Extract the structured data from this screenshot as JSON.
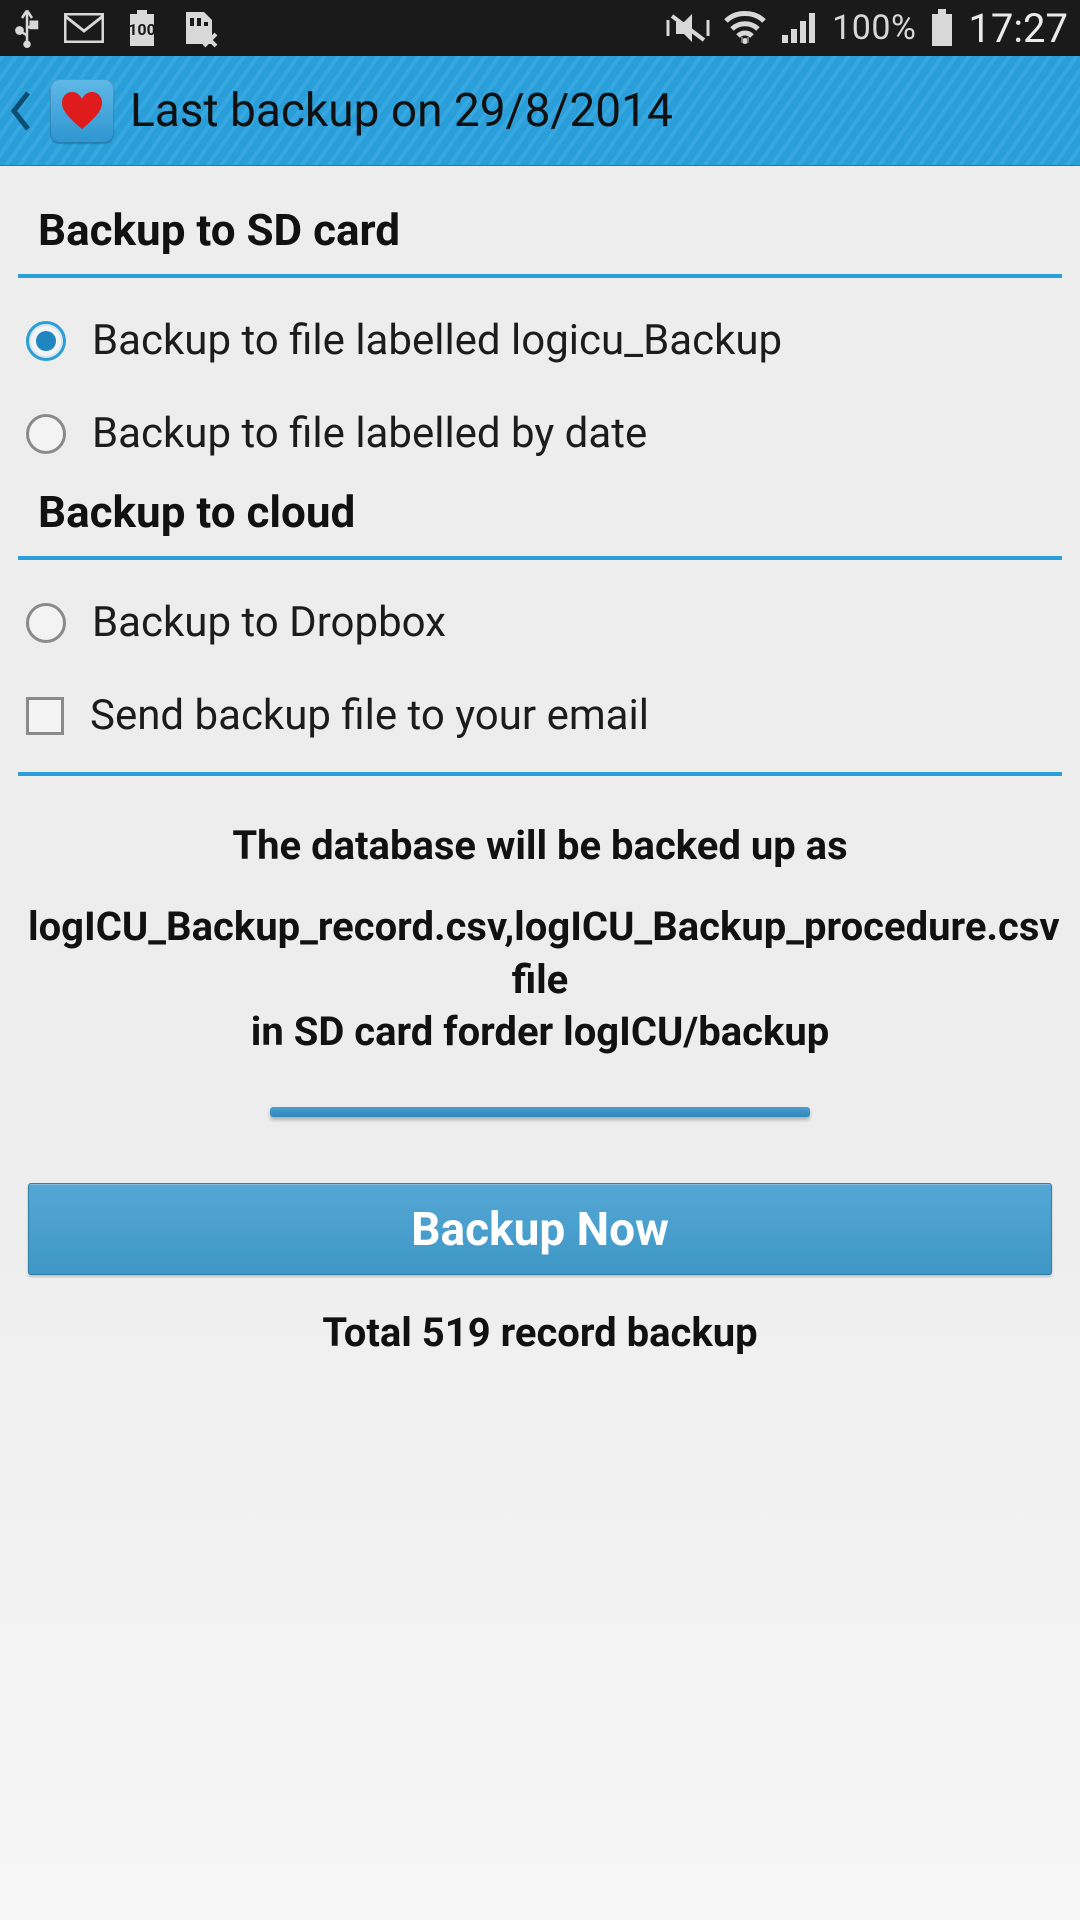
{
  "status": {
    "battery_pct": "100%",
    "clock": "17:27",
    "battery_icon_text": "100"
  },
  "appbar": {
    "title": "Last backup on 29/8/2014"
  },
  "sections": {
    "sd": {
      "header": "Backup to SD card",
      "opt_logicu": "Backup to file labelled logicu_Backup",
      "opt_date": "Backup to file labelled by date"
    },
    "cloud": {
      "header": "Backup to cloud",
      "opt_dropbox": "Backup to Dropbox",
      "opt_email": "Send backup file to your email"
    }
  },
  "info": {
    "line1": "The database will be backed up as",
    "line2": "logICU_Backup_record.csv,logICU_Backup_procedure.csv file",
    "line3": "in SD card forder logICU/backup"
  },
  "button": {
    "label": "Backup Now"
  },
  "total": {
    "label": "Total 519 record backup"
  }
}
